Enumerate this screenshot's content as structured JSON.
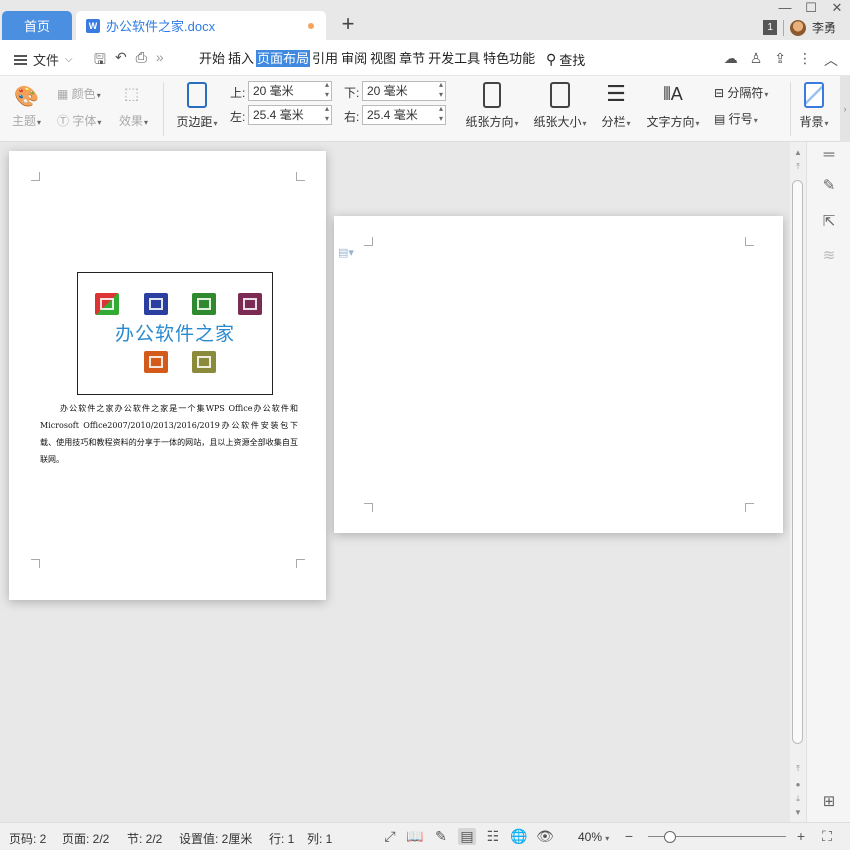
{
  "tabs": {
    "home_label": "首页",
    "doc_label": "办公软件之家.docx",
    "doc_icon": "W",
    "new_tab": "+"
  },
  "titlebar": {
    "badge": "1",
    "user_name": "李勇"
  },
  "menubar": {
    "file_label": "文件",
    "tabs": [
      "开始",
      "插入",
      "页面布局",
      "引用",
      "审阅",
      "视图",
      "章节",
      "开发工具",
      "特色功能"
    ],
    "active_tab": "页面布局",
    "search_label": "查找"
  },
  "ribbon": {
    "theme": "主题",
    "color": "颜色",
    "font": "字体",
    "effect": "效果",
    "margin": "页边距",
    "top_label": "上:",
    "top_value": "20 毫米",
    "bottom_label": "下:",
    "bottom_value": "20 毫米",
    "left_label": "左:",
    "left_value": "25.4 毫米",
    "right_label": "右:",
    "right_value": "25.4 毫米",
    "orientation": "纸张方向",
    "size": "纸张大小",
    "columns": "分栏",
    "text_direction": "文字方向",
    "separator": "分隔符",
    "line_number": "行号",
    "background": "背景"
  },
  "document": {
    "logo_text": "办公软件之家",
    "paragraph": "办公软件之家办公软件之家是一个集WPS Office办公软件和Microsoft Office2007/2010/2013/2016/2019办公软件安装包下载、使用技巧和教程资料的分享于一体的网站，且以上资源全部收集自互联网。"
  },
  "statusbar": {
    "page_no": "页码: 2",
    "pages": "页面: 2/2",
    "section": "节: 2/2",
    "setting": "设置值: 2厘米",
    "row": "行: 1",
    "col": "列: 1",
    "zoom": "40%"
  },
  "colors": {
    "accent": "#4a8fe0",
    "active_tab": "#3f8ae0",
    "logo_text": "#2a8ad0",
    "unsaved_dot": "#f5a25d"
  }
}
